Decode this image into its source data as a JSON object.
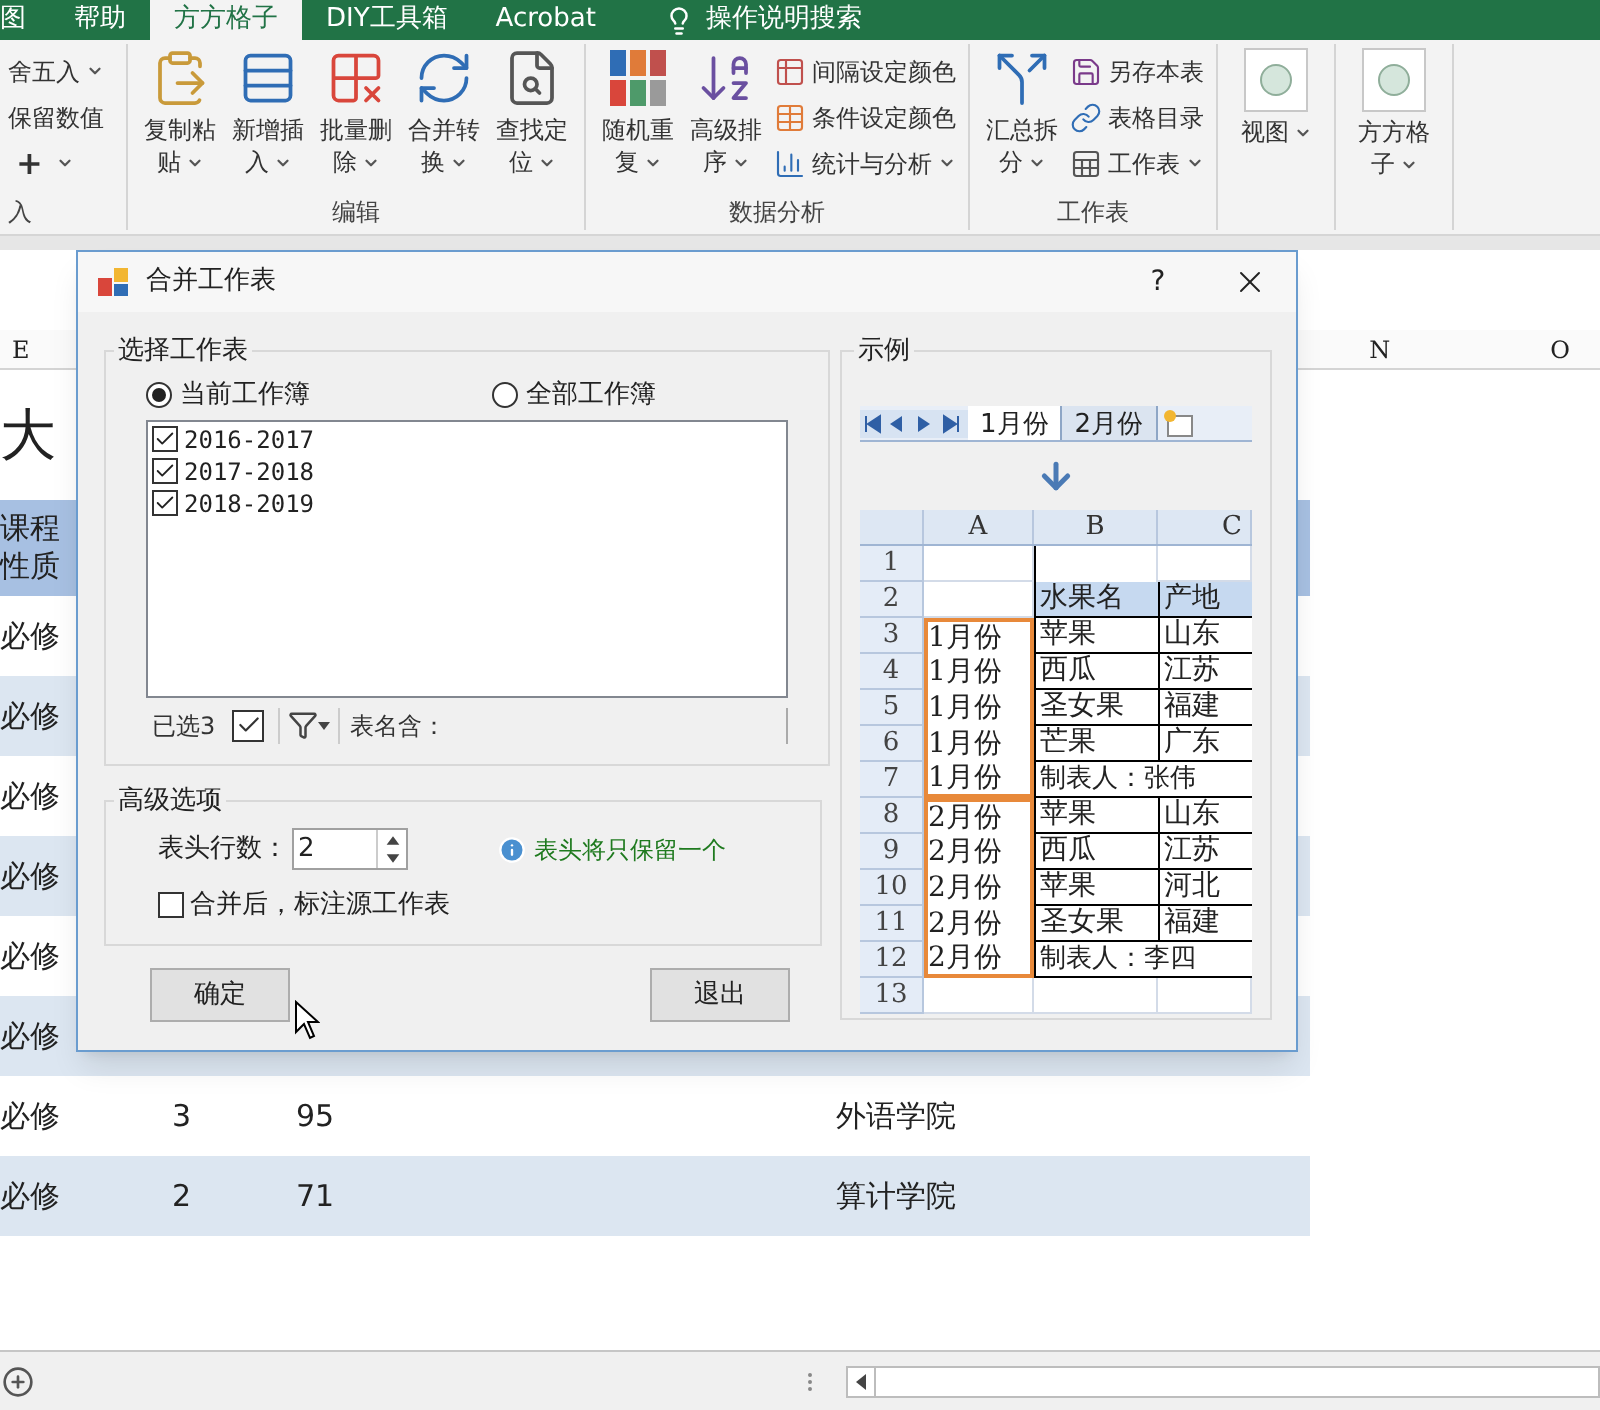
{
  "ribbon": {
    "tabs": [
      {
        "label": "图",
        "selected": false
      },
      {
        "label": "帮助",
        "selected": false
      },
      {
        "label": "方方格子",
        "selected": true
      },
      {
        "label": "DIY工具箱",
        "selected": false
      },
      {
        "label": "Acrobat",
        "selected": false
      }
    ],
    "search": {
      "label": "操作说明搜索"
    },
    "groups": [
      {
        "label": "入",
        "items": [
          {
            "kind": "plain",
            "lines": [
              "舍五入"
            ],
            "dropdown": true
          },
          {
            "kind": "plain",
            "lines": [
              "保留数值"
            ],
            "dropdown": false
          },
          {
            "kind": "plain",
            "lines": [
              "+"
            ],
            "dropdown": true
          }
        ]
      },
      {
        "label": "编辑",
        "items": [
          {
            "kind": "large",
            "lines": [
              "复制粘",
              "贴"
            ],
            "dropdown": true
          },
          {
            "kind": "large",
            "lines": [
              "新增插",
              "入"
            ],
            "dropdown": true
          },
          {
            "kind": "large",
            "lines": [
              "批量删",
              "除"
            ],
            "dropdown": true
          },
          {
            "kind": "large",
            "lines": [
              "合并转",
              "换"
            ],
            "dropdown": true
          },
          {
            "kind": "large",
            "lines": [
              "查找定",
              "位"
            ],
            "dropdown": true
          }
        ]
      },
      {
        "label": "数据分析",
        "items": [
          {
            "kind": "large",
            "lines": [
              "随机重",
              "复"
            ],
            "dropdown": true
          },
          {
            "kind": "large",
            "lines": [
              "高级排",
              "序"
            ],
            "dropdown": true
          },
          {
            "kind": "small",
            "lines": [
              "间隔设定颜色"
            ],
            "dropdown": false
          },
          {
            "kind": "small",
            "lines": [
              "条件设定颜色"
            ],
            "dropdown": false
          },
          {
            "kind": "small",
            "lines": [
              "统计与分析"
            ],
            "dropdown": true
          }
        ]
      },
      {
        "label": "工作表",
        "items": [
          {
            "kind": "large",
            "lines": [
              "汇总拆",
              "分"
            ],
            "dropdown": true
          },
          {
            "kind": "small",
            "lines": [
              "另存本表"
            ],
            "dropdown": false
          },
          {
            "kind": "small",
            "lines": [
              "表格目录"
            ],
            "dropdown": false
          },
          {
            "kind": "small",
            "lines": [
              "工作表"
            ],
            "dropdown": true
          }
        ]
      },
      {
        "items": [
          {
            "kind": "square",
            "lines": [
              "视图"
            ],
            "dropdown": true
          }
        ]
      },
      {
        "items": [
          {
            "kind": "square",
            "lines": [
              "方方格",
              "子"
            ],
            "dropdown": true
          }
        ]
      }
    ]
  },
  "sheet": {
    "column_headers": [
      {
        "label": "E"
      },
      {
        "label": "N"
      },
      {
        "label": "O"
      }
    ],
    "title": "大",
    "header": "课程性质",
    "rows": [
      {
        "shaded": false,
        "cells": [
          "必修"
        ]
      },
      {
        "shaded": true,
        "cells": [
          "必修"
        ]
      },
      {
        "shaded": false,
        "cells": [
          "必修"
        ]
      },
      {
        "shaded": true,
        "cells": [
          "必修"
        ]
      },
      {
        "shaded": false,
        "cells": [
          "必修"
        ]
      },
      {
        "shaded": true,
        "cells": [
          "必修"
        ]
      },
      {
        "shaded": false,
        "cells": [
          "必修",
          "3",
          "95",
          "外语学院"
        ]
      },
      {
        "shaded": true,
        "cells": [
          "必修",
          "2",
          "71",
          "算计学院"
        ]
      }
    ]
  },
  "dialog": {
    "title": "合并工作表",
    "help": "?",
    "sheets_group": {
      "legend": "选择工作表",
      "scopes": [
        {
          "label": "当前工作簿",
          "selected": true
        },
        {
          "label": "全部工作簿",
          "selected": false
        }
      ],
      "sheets": [
        {
          "label": "2016-2017",
          "checked": true
        },
        {
          "label": "2017-2018",
          "checked": true
        },
        {
          "label": "2018-2019",
          "checked": true
        }
      ],
      "selected_count": "已选3",
      "select_all_checked": true,
      "name_filter_label": "表名含："
    },
    "advanced": {
      "legend": "高级选项",
      "header_rows_label": "表头行数：",
      "header_rows_value": "2",
      "hint": "表头将只保留一个",
      "mark_source": {
        "label": "合并后，标注源工作表",
        "checked": false
      }
    },
    "buttons": [
      {
        "label": "确定"
      },
      {
        "label": "退出"
      }
    ],
    "example": {
      "legend": "示例",
      "tabs": [
        {
          "label": "1月份",
          "selected": true
        },
        {
          "label": "2月份",
          "selected": false
        }
      ],
      "columns": [
        "A",
        "B",
        "C"
      ],
      "rows": [
        {
          "num": "1",
          "kind": "blank",
          "outlined": false,
          "group_start": false,
          "group_end": false
        },
        {
          "num": "2",
          "kind": "header",
          "outlined": false,
          "group_start": false,
          "group_end": false,
          "b": "水果名",
          "c": "产地"
        },
        {
          "num": "3",
          "kind": "data",
          "outlined": true,
          "group_start": true,
          "group_end": false,
          "a": "1月份",
          "b": "苹果",
          "c": "山东"
        },
        {
          "num": "4",
          "kind": "data",
          "outlined": true,
          "group_start": false,
          "group_end": false,
          "a": "1月份",
          "b": "西瓜",
          "c": "江苏"
        },
        {
          "num": "5",
          "kind": "data",
          "outlined": true,
          "group_start": false,
          "group_end": false,
          "a": "1月份",
          "b": "圣女果",
          "c": "福建"
        },
        {
          "num": "6",
          "kind": "data",
          "outlined": true,
          "group_start": false,
          "group_end": false,
          "a": "1月份",
          "b": "芒果",
          "c": "广东"
        },
        {
          "num": "7",
          "kind": "signature",
          "outlined": true,
          "group_start": false,
          "group_end": true,
          "a": "1月份",
          "b": "制表人：张伟"
        },
        {
          "num": "8",
          "kind": "data",
          "outlined": true,
          "group_start": true,
          "group_end": false,
          "a": "2月份",
          "b": "苹果",
          "c": "山东"
        },
        {
          "num": "9",
          "kind": "data",
          "outlined": true,
          "group_start": false,
          "group_end": false,
          "a": "2月份",
          "b": "西瓜",
          "c": "江苏"
        },
        {
          "num": "10",
          "kind": "data",
          "outlined": true,
          "group_start": false,
          "group_end": false,
          "a": "2月份",
          "b": "苹果",
          "c": "河北"
        },
        {
          "num": "11",
          "kind": "data",
          "outlined": true,
          "group_start": false,
          "group_end": false,
          "a": "2月份",
          "b": "圣女果",
          "c": "福建"
        },
        {
          "num": "12",
          "kind": "signature",
          "outlined": true,
          "group_start": false,
          "group_end": true,
          "a": "2月份",
          "b": "制表人：李四"
        },
        {
          "num": "13",
          "kind": "blank",
          "outlined": false,
          "group_start": false,
          "group_end": false
        }
      ]
    }
  }
}
